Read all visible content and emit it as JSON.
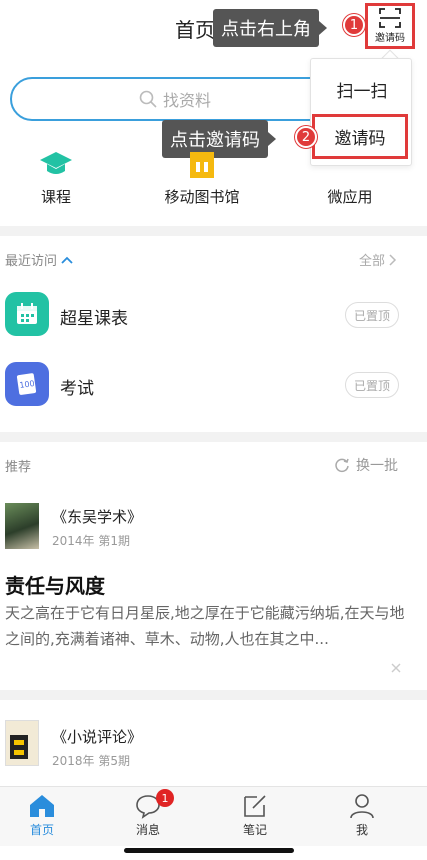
{
  "header": {
    "title": "首页",
    "scan_button_label": "邀请码",
    "tip1": "点击右上角",
    "tip2": "点击邀请码",
    "step1": "1",
    "step2": "2"
  },
  "search": {
    "placeholder": "找资料"
  },
  "menu": {
    "items": [
      "扫一扫",
      "邀请码"
    ]
  },
  "quick": [
    {
      "label": "课程",
      "icon": "graduation-cap-icon"
    },
    {
      "label": "移动图书馆",
      "icon": "library-building-icon"
    },
    {
      "label": "微应用",
      "icon": "apps-icon"
    }
  ],
  "recent": {
    "label": "最近访问",
    "all_label": "全部",
    "items": [
      {
        "title": "超星课表",
        "badge": "已置顶",
        "icon": "calendar-icon"
      },
      {
        "title": "考试",
        "badge": "已置顶",
        "icon": "exam-100-icon"
      }
    ]
  },
  "recommend": {
    "label": "推荐",
    "refresh_label": "换一批",
    "articles": [
      {
        "magazine": "《东吴学术》",
        "date": "2014年 第1期",
        "title": "责任与风度",
        "desc": "天之高在于它有日月星辰,地之厚在于它能藏污纳垢,在天与地之间的,充满着诸神、草木、动物,人也在其之中..."
      },
      {
        "magazine": "《小说评论》",
        "date": "2018年 第5期"
      }
    ]
  },
  "tabbar": {
    "items": [
      {
        "label": "首页",
        "icon": "home-icon"
      },
      {
        "label": "消息",
        "icon": "message-icon",
        "badge": "1"
      },
      {
        "label": "笔记",
        "icon": "note-icon"
      },
      {
        "label": "我",
        "icon": "profile-icon"
      }
    ]
  },
  "colors": {
    "accent": "#2a8ddc",
    "highlight": "#e03a3a",
    "teal": "#22c2a4"
  }
}
